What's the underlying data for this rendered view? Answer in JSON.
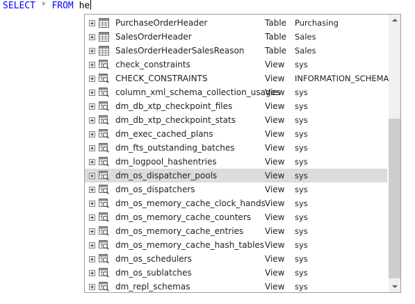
{
  "editor": {
    "keyword_select": "SELECT",
    "operator_star": "*",
    "keyword_from": "FROM",
    "typed_text": "he"
  },
  "completion": {
    "selected_index": 11,
    "icons": {
      "table": "table-icon",
      "view": "view-icon",
      "expander": "plus-box-icon"
    },
    "items": [
      {
        "name": "PurchaseOrderHeader",
        "type": "Table",
        "schema": "Purchasing",
        "kind": "table"
      },
      {
        "name": "SalesOrderHeader",
        "type": "Table",
        "schema": "Sales",
        "kind": "table"
      },
      {
        "name": "SalesOrderHeaderSalesReason",
        "type": "Table",
        "schema": "Sales",
        "kind": "table"
      },
      {
        "name": "check_constraints",
        "type": "View",
        "schema": "sys",
        "kind": "view"
      },
      {
        "name": "CHECK_CONSTRAINTS",
        "type": "View",
        "schema": "INFORMATION_SCHEMA",
        "kind": "view"
      },
      {
        "name": "column_xml_schema_collection_usages",
        "type": "View",
        "schema": "sys",
        "kind": "view"
      },
      {
        "name": "dm_db_xtp_checkpoint_files",
        "type": "View",
        "schema": "sys",
        "kind": "view"
      },
      {
        "name": "dm_db_xtp_checkpoint_stats",
        "type": "View",
        "schema": "sys",
        "kind": "view"
      },
      {
        "name": "dm_exec_cached_plans",
        "type": "View",
        "schema": "sys",
        "kind": "view"
      },
      {
        "name": "dm_fts_outstanding_batches",
        "type": "View",
        "schema": "sys",
        "kind": "view"
      },
      {
        "name": "dm_logpool_hashentries",
        "type": "View",
        "schema": "sys",
        "kind": "view"
      },
      {
        "name": "dm_os_dispatcher_pools",
        "type": "View",
        "schema": "sys",
        "kind": "view"
      },
      {
        "name": "dm_os_dispatchers",
        "type": "View",
        "schema": "sys",
        "kind": "view"
      },
      {
        "name": "dm_os_memory_cache_clock_hands",
        "type": "View",
        "schema": "sys",
        "kind": "view"
      },
      {
        "name": "dm_os_memory_cache_counters",
        "type": "View",
        "schema": "sys",
        "kind": "view"
      },
      {
        "name": "dm_os_memory_cache_entries",
        "type": "View",
        "schema": "sys",
        "kind": "view"
      },
      {
        "name": "dm_os_memory_cache_hash_tables",
        "type": "View",
        "schema": "sys",
        "kind": "view"
      },
      {
        "name": "dm_os_schedulers",
        "type": "View",
        "schema": "sys",
        "kind": "view"
      },
      {
        "name": "dm_os_sublatches",
        "type": "View",
        "schema": "sys",
        "kind": "view"
      },
      {
        "name": "dm_repl_schemas",
        "type": "View",
        "schema": "sys",
        "kind": "view"
      }
    ]
  }
}
